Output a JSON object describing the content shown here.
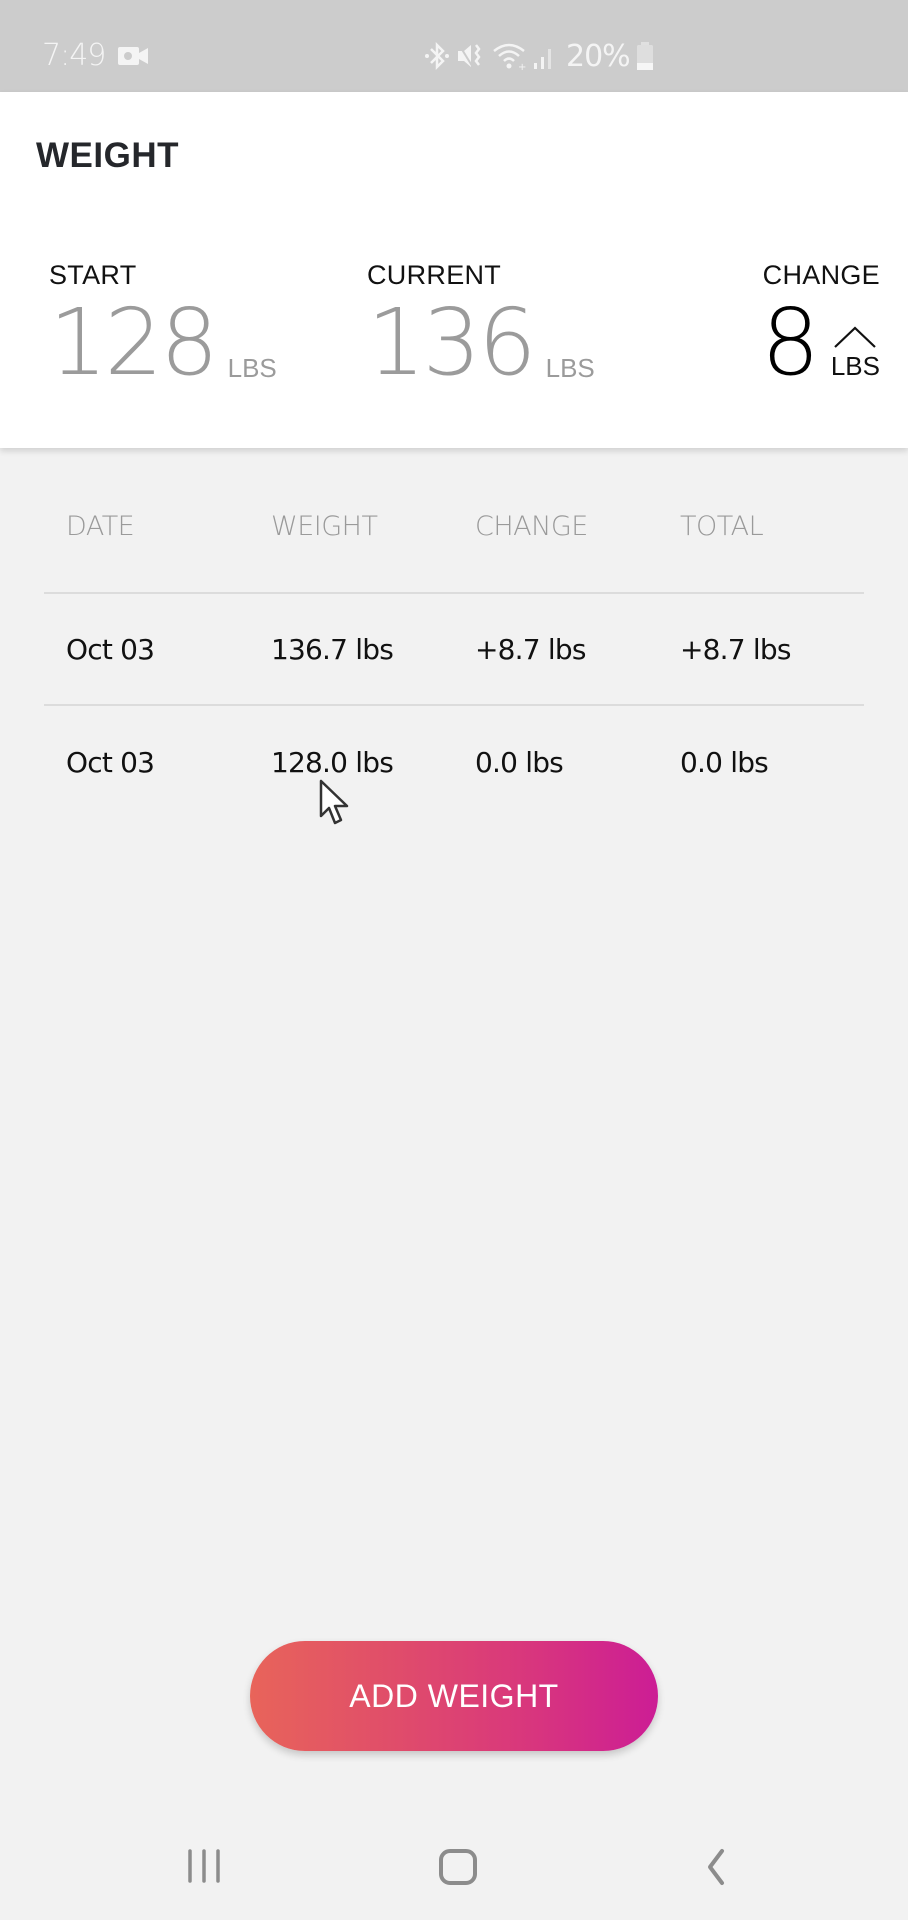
{
  "status_bar": {
    "time": "7:49",
    "battery_percent": "20%",
    "icons": [
      "video-camera-icon",
      "bluetooth-icon",
      "mute-vibrate-icon",
      "wifi-icon",
      "signal-icon",
      "battery-icon"
    ]
  },
  "header": {
    "title": "WEIGHT"
  },
  "summary": {
    "start": {
      "label": "START",
      "value": "128",
      "unit": "LBS"
    },
    "current": {
      "label": "CURRENT",
      "value": "136",
      "unit": "LBS"
    },
    "change": {
      "label": "CHANGE",
      "value": "8",
      "unit": "LBS",
      "direction_icon": "chevron-up-icon"
    }
  },
  "table": {
    "columns": [
      "DATE",
      "WEIGHT",
      "CHANGE",
      "TOTAL"
    ],
    "rows": [
      [
        "Oct 03",
        "136.7 lbs",
        "+8.7 lbs",
        "+8.7 lbs"
      ],
      [
        "Oct 03",
        "128.0 lbs",
        "0.0 lbs",
        "0.0 lbs"
      ]
    ]
  },
  "actions": {
    "add_weight_label": "ADD WEIGHT",
    "gradient_start": "#e8645a",
    "gradient_end": "#cc1d95"
  },
  "navbar": {
    "items": [
      "recent-apps",
      "home",
      "back"
    ]
  }
}
